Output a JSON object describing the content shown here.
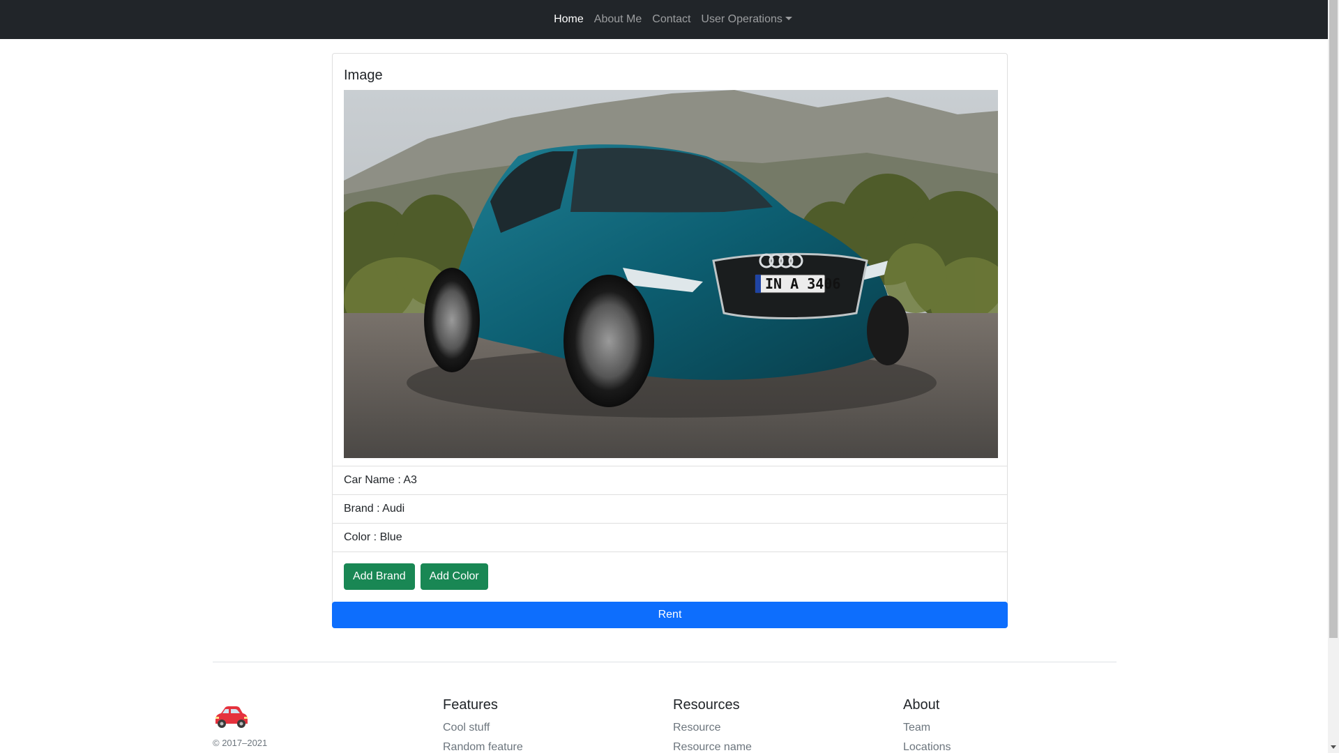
{
  "nav": {
    "items": [
      {
        "label": "Home",
        "active": true
      },
      {
        "label": "About Me"
      },
      {
        "label": "Contact"
      },
      {
        "label": "User Operations",
        "dropdown": true
      }
    ]
  },
  "card": {
    "title": "Image",
    "image_icon": "car-photo",
    "fields": [
      {
        "label": "Car Name : A3"
      },
      {
        "label": "Brand : Audi"
      },
      {
        "label": "Color : Blue"
      }
    ],
    "buttons": {
      "add_brand": "Add Brand",
      "add_color": "Add Color",
      "rent": "Rent"
    }
  },
  "footer": {
    "brand_icon": "car-icon",
    "copyright": "© 2017–2021",
    "columns": [
      {
        "title": "Features",
        "links": [
          "Cool stuff",
          "Random feature"
        ]
      },
      {
        "title": "Resources",
        "links": [
          "Resource",
          "Resource name"
        ]
      },
      {
        "title": "About",
        "links": [
          "Team",
          "Locations"
        ]
      }
    ]
  },
  "colors": {
    "navbar": "#212529",
    "success": "#198754",
    "primary": "#0d6efd",
    "muted": "#6c757d"
  }
}
